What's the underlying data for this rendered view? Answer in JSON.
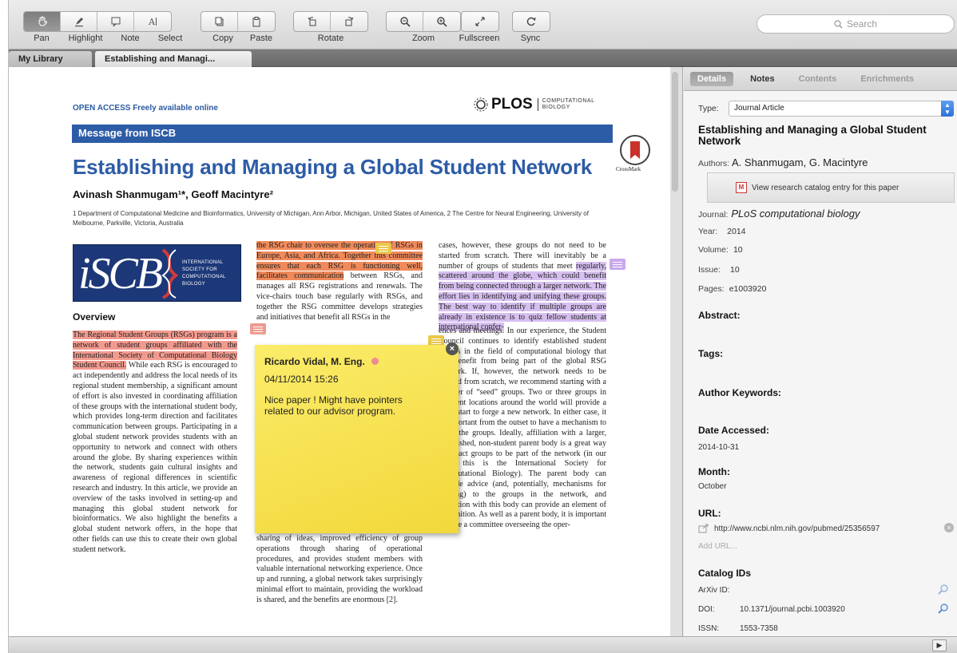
{
  "toolbar": {
    "pan": "Pan",
    "highlight": "Highlight",
    "note": "Note",
    "select": "Select",
    "copy": "Copy",
    "paste": "Paste",
    "rotate": "Rotate",
    "zoom": "Zoom",
    "fullscreen": "Fullscreen",
    "sync": "Sync",
    "search_placeholder": "Search"
  },
  "tabs": {
    "library": "My Library",
    "document": "Establishing and Managi..."
  },
  "document": {
    "open_access": "OPEN ACCESS Freely available online",
    "plos_word": "PLOS",
    "plos_sub1": "COMPUTATIONAL",
    "plos_sub2": "BIOLOGY",
    "message": "Message from ISCB",
    "crossmark": "CrossMark",
    "title": "Establishing and Managing a Global Student Network",
    "authors": "Avinash Shanmugam¹*, Geoff Macintyre²",
    "affiliation": "1 Department of Computational Medicine and Bioinformatics, University of Michigan, Ann Arbor, Michigan, United States of America, 2 The Centre for Neural Engineering, University of Melbourne, Parkville, Victoria, Australia",
    "iscb_big": "iSCB",
    "iscb_small1": "INTERNATIONAL",
    "iscb_small2": "SOCIETY FOR",
    "iscb_small3": "COMPUTATIONAL",
    "iscb_small4": "BIOLOGY",
    "overview": "Overview",
    "col1_hl": "The Regional Student Groups (RSGs) program is a network of student groups affiliated with the International Society of Computational Biology Student Council.",
    "col1_rest": " While each RSG is encouraged to act independently and address the local needs of its regional student membership, a significant amount of effort is also invested in coordinating affiliation of these groups with the international student body, which provides long-term direction and facilitates communication between groups. Participating in a global student network provides students with an opportunity to network and connect with others around the globe. By sharing experiences within the network, students gain cultural insights and awareness of regional differences in scientific research and industry. In this article, we provide an overview of the tasks involved in setting-up and managing this global student network for bioinformatics. We also highlight the benefits a global student network offers, in the hope that other fields can use this to create their own global student network.",
    "col2_hl": "the RSG chair to oversee the operation of RSGs in Europe, Asia, and Africa. Together this committee ensures that each RSG is functioning well, facilitates communication",
    "col2_rest": " between RSGs, and manages all RSG registrations and renewals. The vice-chairs touch base regularly with RSGs, and together the RSG committee develops strategies and initiatives that benefit all RSGs in the",
    "col2b": "sharing of ideas, improved efficiency of group operations through sharing of operational procedures, and provides student members with valuable international networking experience. Once up and running, a global network takes surprisingly minimal effort to maintain, providing the workload is shared, and the benefits are enormous [2].",
    "col3_pre": "cases, however, these groups do not need to be started from scratch. There will inevitably be a number of groups of students that meet ",
    "col3_hl": "regularly, scattered around the globe, which could benefit from being connected through a larger network. The effort lies in identifying and unifying these groups. The best way to identify if multiple groups are already in existence is to quiz fellow students at international confer-",
    "col3b": "ences and meetings. In our experience, the Student Council continues to identify established student groups in the field of computational biology that can benefit from being part of the global RSG network. If, however, the network needs to be created from scratch, we recommend starting with a number of “seed” groups. Two or three groups in different locations around the world will provide a great start to forge a new network. In either case, it is important from the outset to have a mechanism to unify the groups. Ideally, affiliation with a larger, established, non-student parent body is a great way to attract groups to be part of the network (in our case, this is the International Society for Computational Biology). The parent body can provide advice (and, potentially, mechanisms for funding) to the groups in the network, and affiliation with this body can provide an element of recognition. As well as a parent body, it is important to have a committee overseeing the oper-"
  },
  "sticky_note": {
    "author": "Ricardo Vidal, M. Eng.",
    "date": "04/11/2014 15:26",
    "text": "Nice paper ! Might have pointers related to our advisor program.",
    "close": "×"
  },
  "panel": {
    "tabs": [
      "Details",
      "Notes",
      "Contents",
      "Enrichments"
    ],
    "type_label": "Type:",
    "type_value": "Journal Article",
    "title": "Establishing and Managing a Global Student Network",
    "authors_label": "Authors:",
    "authors_value": "A. Shanmugam, G. Macintyre",
    "catalog_button": "View research catalog entry for this paper",
    "journal_label": "Journal:",
    "journal_value": "PLoS computational biology",
    "year_label": "Year:",
    "year_value": "2014",
    "volume_label": "Volume:",
    "volume_value": "10",
    "issue_label": "Issue:",
    "issue_value": "10",
    "pages_label": "Pages:",
    "pages_value": "e1003920",
    "abstract": "Abstract:",
    "tags": "Tags:",
    "author_keywords": "Author Keywords:",
    "date_accessed": "Date Accessed:",
    "date_accessed_value": "2014-10-31",
    "month": "Month:",
    "month_value": "October",
    "url": "URL:",
    "url_value": "http://www.ncbi.nlm.nih.gov/pubmed/25356597",
    "add_url": "Add URL...",
    "catalog_ids": "Catalog IDs",
    "arxiv_label": "ArXiv ID:",
    "doi_label": "DOI:",
    "doi_value": "10.1371/journal.pcbi.1003920",
    "issn_label": "ISSN:",
    "issn_value": "1553-7358"
  },
  "colors": {
    "plos_blue": "#2d5ca6",
    "highlight_red": "#f39a8f",
    "highlight_orange": "#f08a5b",
    "highlight_purple": "#d7bff0",
    "sticky_yellow": "#f7e152"
  }
}
